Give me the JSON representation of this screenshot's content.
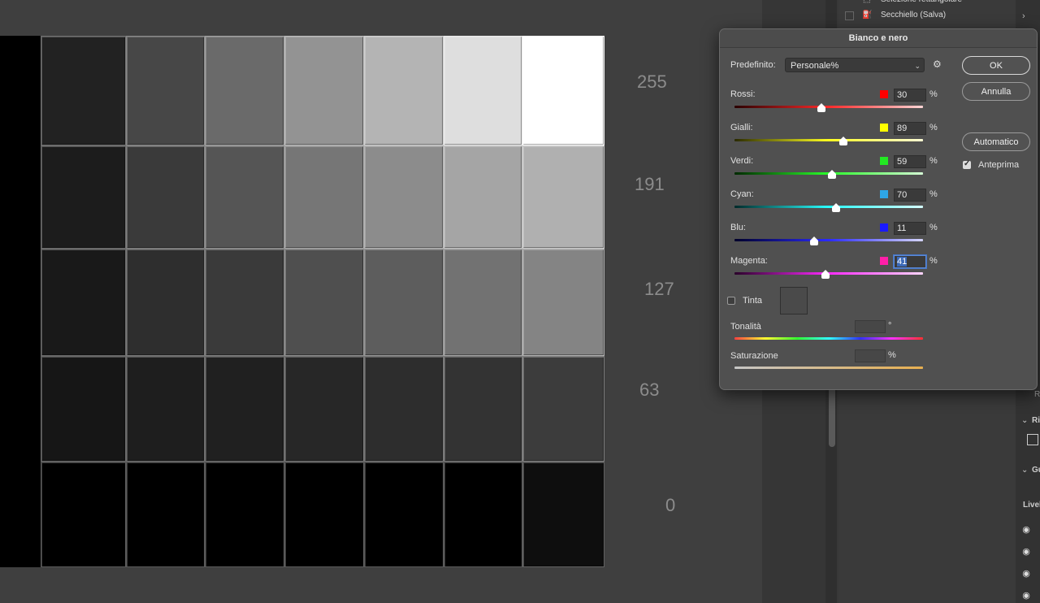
{
  "canvas": {
    "scale_labels": [
      "255",
      "191",
      "127",
      "63",
      "0"
    ],
    "grid_colors": [
      [
        "#222222",
        "#474747",
        "#6a6a6a",
        "#939393",
        "#b4b4b4",
        "#dedede",
        "#ffffff"
      ],
      [
        "#1c1c1c",
        "#3a3a3a",
        "#555555",
        "#767676",
        "#8c8c8c",
        "#a5a5a5",
        "#b0b0b0"
      ],
      [
        "#191919",
        "#2e2e2e",
        "#3a3a3a",
        "#4f4f4f",
        "#5d5d5d",
        "#727272",
        "#848484"
      ],
      [
        "#161616",
        "#1e1e1e",
        "#202020",
        "#272727",
        "#2d2d2d",
        "#333333",
        "#3c3c3c"
      ],
      [
        "#000000",
        "#000000",
        "#000000",
        "#000000",
        "#000000",
        "#000000",
        "#0e0e0e"
      ]
    ]
  },
  "history": {
    "items": [
      {
        "label": "Selezione rettangolare"
      },
      {
        "label": "Secchiello (Salva)"
      }
    ]
  },
  "right_edge": {
    "labels": [
      "R",
      "Ri",
      "Gu",
      "Livel"
    ]
  },
  "dialog": {
    "title": "Bianco e nero",
    "preset_label": "Predefinito:",
    "preset_value": "Personale%",
    "buttons": {
      "ok": "OK",
      "cancel": "Annulla",
      "auto": "Automatico"
    },
    "preview": {
      "label": "Anteprima",
      "checked": true
    },
    "channels": [
      {
        "label": "Rossi:",
        "value": "30",
        "pct": 30,
        "color": "#ff0000",
        "track": "linear-gradient(90deg,#2a0000,#ff2a2a,#ffd5d5)"
      },
      {
        "label": "Gialli:",
        "value": "89",
        "pct": 89,
        "color": "#ffff00",
        "track": "linear-gradient(90deg,#2a2a00,#ffff20,#ffffd5)"
      },
      {
        "label": "Verdi:",
        "value": "59",
        "pct": 59,
        "color": "#22e822",
        "track": "linear-gradient(90deg,#002a00,#2aff2a,#d5ffd5)"
      },
      {
        "label": "Cyan:",
        "value": "70",
        "pct": 70,
        "color": "#2ea6e6",
        "track": "linear-gradient(90deg,#002a2a,#2affff,#d5ffff)"
      },
      {
        "label": "Blu:",
        "value": "11",
        "pct": 11,
        "color": "#1a1aff",
        "track": "linear-gradient(90deg,#00002a,#2a2aff,#d5d5ff)"
      },
      {
        "label": "Magenta:",
        "value": "41",
        "pct": 41,
        "color": "#ff1fa8",
        "track": "linear-gradient(90deg,#2a002a,#ff2aff,#ffd5ff)"
      }
    ],
    "pct_sign": "%",
    "tint": {
      "label": "Tinta",
      "checked": false
    },
    "hue": {
      "label": "Tonalità",
      "unit": "°"
    },
    "saturation": {
      "label": "Saturazione",
      "unit": "%"
    }
  }
}
